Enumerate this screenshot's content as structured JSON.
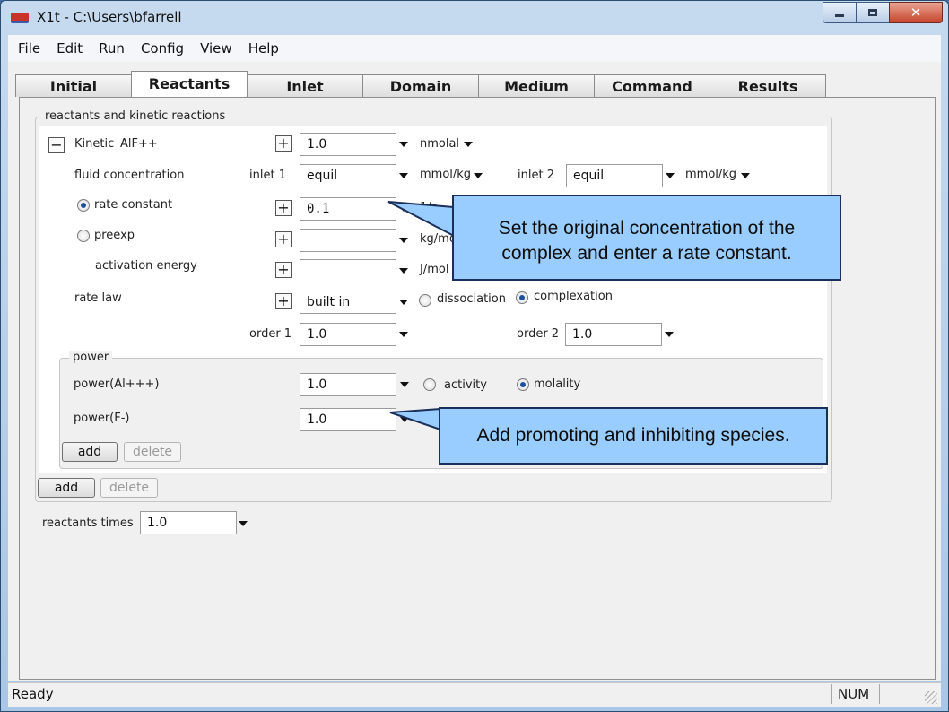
{
  "window": {
    "title": "X1t - C:\\Users\\bfarrell"
  },
  "menu": [
    "File",
    "Edit",
    "Run",
    "Config",
    "View",
    "Help"
  ],
  "tabs": [
    "Initial",
    "Reactants",
    "Inlet",
    "Domain",
    "Medium",
    "Command",
    "Results"
  ],
  "active_tab": "Reactants",
  "group": {
    "title": "reactants and kinetic reactions",
    "kinetic": {
      "collapse": "−",
      "label": "Kinetic",
      "species": "AlF++",
      "amount": "1.0",
      "amount_unit": "nmolal"
    },
    "fluid": {
      "label": "fluid concentration",
      "inlet1_label": "inlet 1",
      "inlet1_value": "equil",
      "inlet1_unit": "mmol/kg",
      "inlet2_label": "inlet 2",
      "inlet2_value": "equil",
      "inlet2_unit": "mmol/kg"
    },
    "rate_constant": {
      "label": "rate constant",
      "value": "0.1",
      "unit": "1/s"
    },
    "preexp": {
      "label": "preexp",
      "value": "",
      "unit": "kg/mol"
    },
    "activation_energy": {
      "label": "activation energy",
      "value": "",
      "unit": "J/mol"
    },
    "rate_law": {
      "label": "rate law",
      "value": "built in",
      "option_dissociation": "dissociation",
      "option_complexation": "complexation",
      "selected": "complexation"
    },
    "order": {
      "order1_label": "order 1",
      "order1_value": "1.0",
      "order2_label": "order 2",
      "order2_value": "1.0"
    },
    "power": {
      "title": "power",
      "row1_label": "power(Al+++)",
      "row1_value": "1.0",
      "row1_opt_activity": "activity",
      "row1_opt_molality": "molality",
      "row2_label": "power(F-)",
      "row2_value": "1.0",
      "add": "add",
      "delete": "delete"
    },
    "add": "add",
    "delete": "delete"
  },
  "reactants_times": {
    "label": "reactants times",
    "value": "1.0"
  },
  "callouts": {
    "top": [
      "Set the original concentration of the",
      "complex and enter a rate constant."
    ],
    "bottom": "Add promoting and inhibiting species."
  },
  "status": {
    "text": "Ready",
    "num": "NUM"
  },
  "icons": [
    "app-icon",
    "minimize-icon",
    "maximize-icon",
    "close-icon",
    "dropdown-arrow-icon",
    "plus-icon",
    "resize-grip-icon"
  ],
  "colors": {
    "callout_fill": "#99ccff",
    "callout_border": "#1a2f5a",
    "radio_selected": "#1c4f9c"
  }
}
